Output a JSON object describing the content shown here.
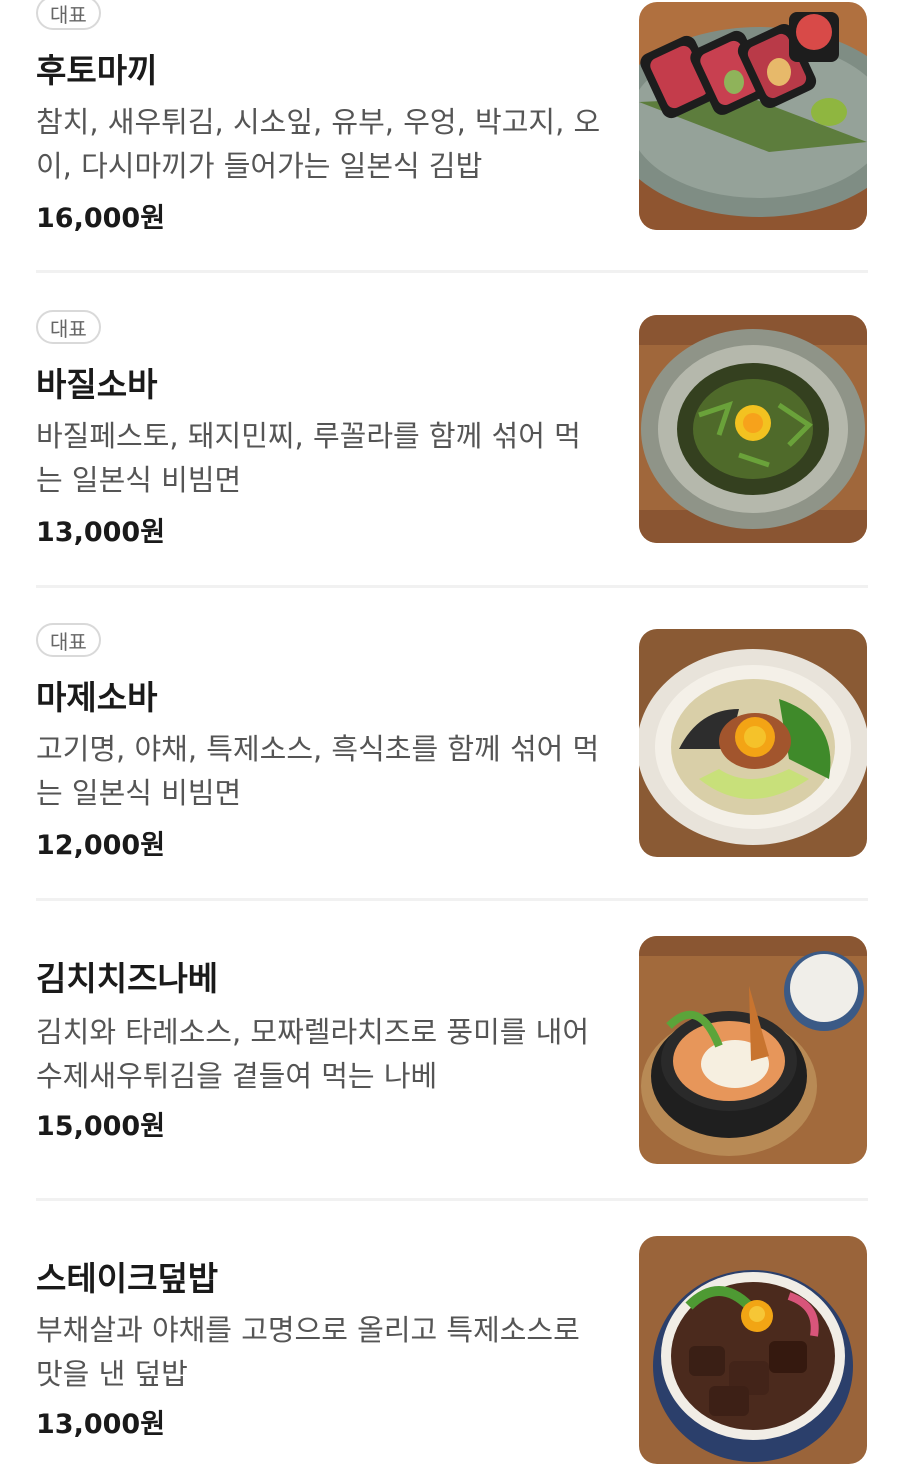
{
  "menu": {
    "items": [
      {
        "badge": "대표",
        "name": "후토마끼",
        "description": "참치, 새우튀김, 시소잎, 유부, 우엉, 박고지, 오이, 다시마끼가 들어가는 일본식 김밥",
        "price": "16,000원",
        "image_icon": "futomaki-photo"
      },
      {
        "badge": "대표",
        "name": "바질소바",
        "description": "바질페스토, 돼지민찌, 루꼴라를 함께 섞어 먹는 일본식 비빔면",
        "price": "13,000원",
        "image_icon": "basil-soba-photo"
      },
      {
        "badge": "대표",
        "name": "마제소바",
        "description": "고기명, 야채, 특제소스, 흑식초를 함께 섞어 먹는 일본식 비빔면",
        "price": "12,000원",
        "image_icon": "maze-soba-photo"
      },
      {
        "name": "김치치즈나베",
        "description": "김치와 타레소스, 모짜렐라치즈로 풍미를 내어 수제새우튀김을 곁들여 먹는 나베",
        "price": "15,000원",
        "image_icon": "kimchi-cheese-nabe-photo"
      },
      {
        "name": "스테이크덮밥",
        "description": "부채살과 야채를 고명으로 올리고 특제소스로 맛을 낸 덮밥",
        "price": "13,000원",
        "image_icon": "steak-donburi-photo"
      }
    ]
  },
  "colors": {
    "text_primary": "#1a1a1a",
    "text_secondary": "#555555",
    "badge_border": "#d9d9d9",
    "divider": "#f1f1f1"
  }
}
